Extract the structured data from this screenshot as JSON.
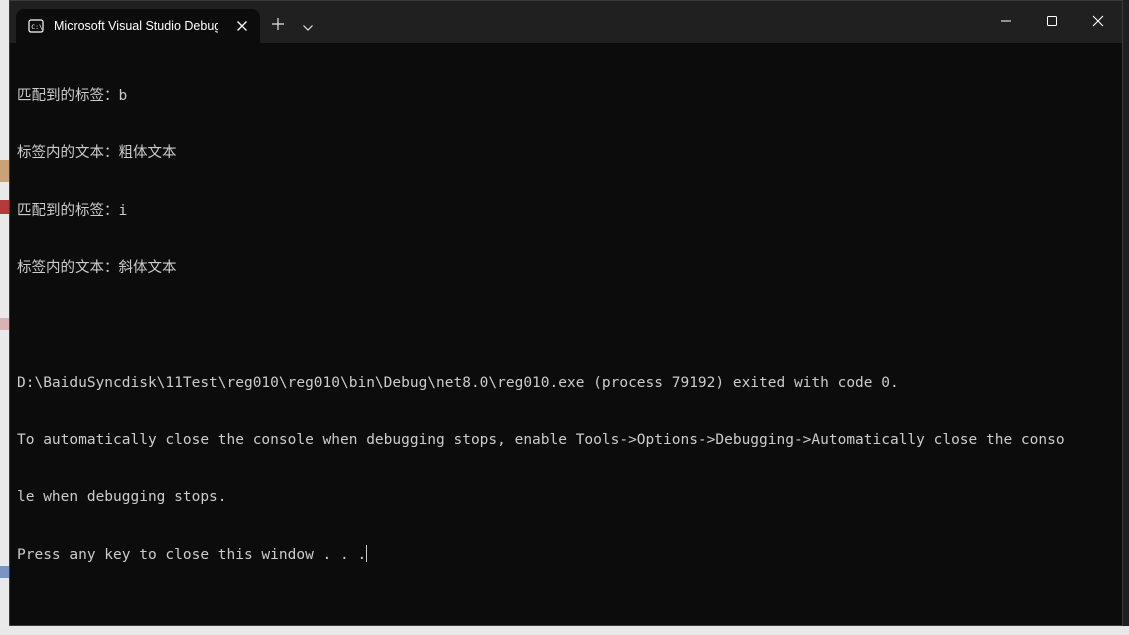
{
  "window": {
    "tab_title": "Microsoft Visual Studio Debug Console"
  },
  "console": {
    "lines": [
      "匹配到的标签：b",
      "标签内的文本：粗体文本",
      "匹配到的标签：i",
      "标签内的文本：斜体文本",
      "",
      "D:\\BaiduSyncdisk\\11Test\\reg010\\reg010\\bin\\Debug\\net8.0\\reg010.exe (process 79192) exited with code 0.",
      "To automatically close the console when debugging stops, enable Tools->Options->Debugging->Automatically close the conso",
      "le when debugging stops.",
      "Press any key to close this window . . ."
    ]
  },
  "colors": {
    "console_bg": "#0c0c0c",
    "titlebar_bg": "#202020",
    "text": "#cccccc"
  },
  "icons": {
    "tab_icon": "console-app-icon",
    "tab_close": "close-icon",
    "new_tab": "plus-icon",
    "dropdown": "chevron-down-icon",
    "minimize": "minimize-icon",
    "maximize": "maximize-icon",
    "close": "close-icon"
  }
}
